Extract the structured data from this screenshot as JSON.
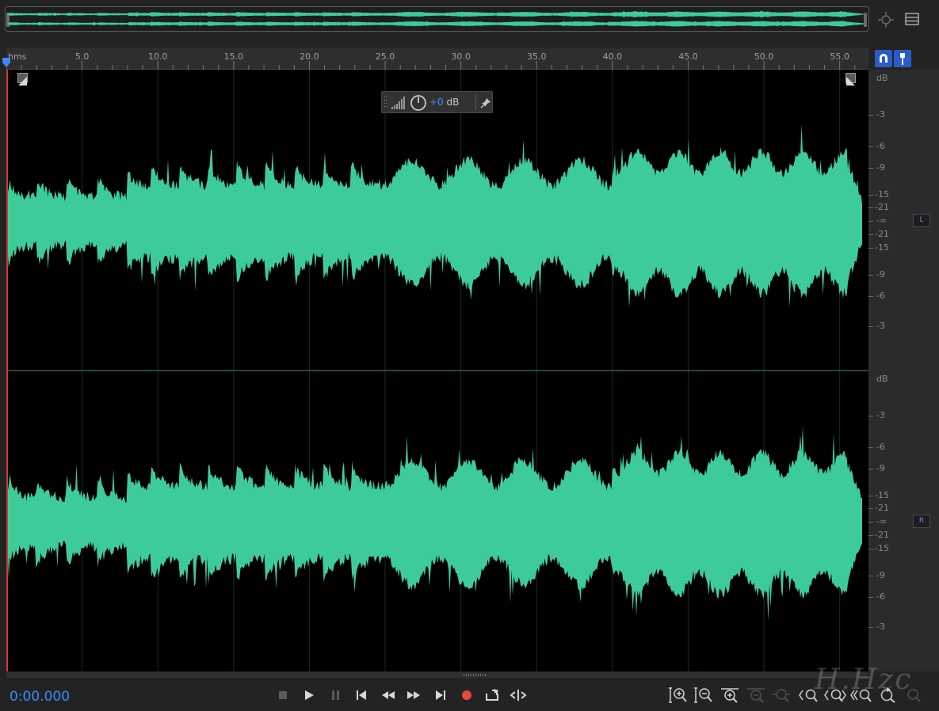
{
  "overview": {
    "zoom_icon": "zoom-navigator-icon",
    "menu_icon": "panel-menu-icon"
  },
  "ruler": {
    "unit_label": "hms",
    "ticks": [
      "5.0",
      "10.0",
      "15.0",
      "20.0",
      "25.0",
      "30.0",
      "35.0",
      "40.0",
      "45.0",
      "50.0",
      "55.0"
    ],
    "view_end_seconds": 56.9
  },
  "snap_buttons": {
    "snap_icon": "magnet-icon",
    "marker_icon": "marker-pin-icon"
  },
  "hud": {
    "value_number": "+0",
    "value_unit": " dB",
    "level_icon": "level-bars-icon",
    "knob_icon": "volume-knob-icon",
    "pin_icon": "pin-icon"
  },
  "channels": [
    {
      "id": "L",
      "label": "L"
    },
    {
      "id": "R",
      "label": "R"
    }
  ],
  "db_scale": {
    "unit": "dB",
    "labels": [
      "-3",
      "-6",
      "-9",
      "-15",
      "-21",
      "-∞",
      "-21",
      "-15",
      "-9",
      "-6",
      "-3"
    ]
  },
  "transport": {
    "timecode": "0:00.000",
    "buttons": [
      "stop-icon",
      "play-icon",
      "pause-icon",
      "go-to-start-icon",
      "rewind-icon",
      "fast-forward-icon",
      "go-to-end-icon",
      "record-icon",
      "loop-playback-icon",
      "skip-selection-icon"
    ]
  },
  "zoom_controls": [
    "zoom-in-amplitude-icon",
    "zoom-out-amplitude-icon",
    "zoom-in-time-icon",
    "zoom-out-time-icon",
    "zoom-out-full-icon",
    "zoom-in-point-icon",
    "zoom-out-point-icon",
    "zoom-to-selection-icon",
    "zoom-reset-icon",
    "zoom-selection-icon"
  ],
  "colors": {
    "waveform": "#3ecb9b",
    "accent": "#3d88ff",
    "playhead": "#d23a2a",
    "record": "#e8453c"
  },
  "watermark": "H.Hzc"
}
